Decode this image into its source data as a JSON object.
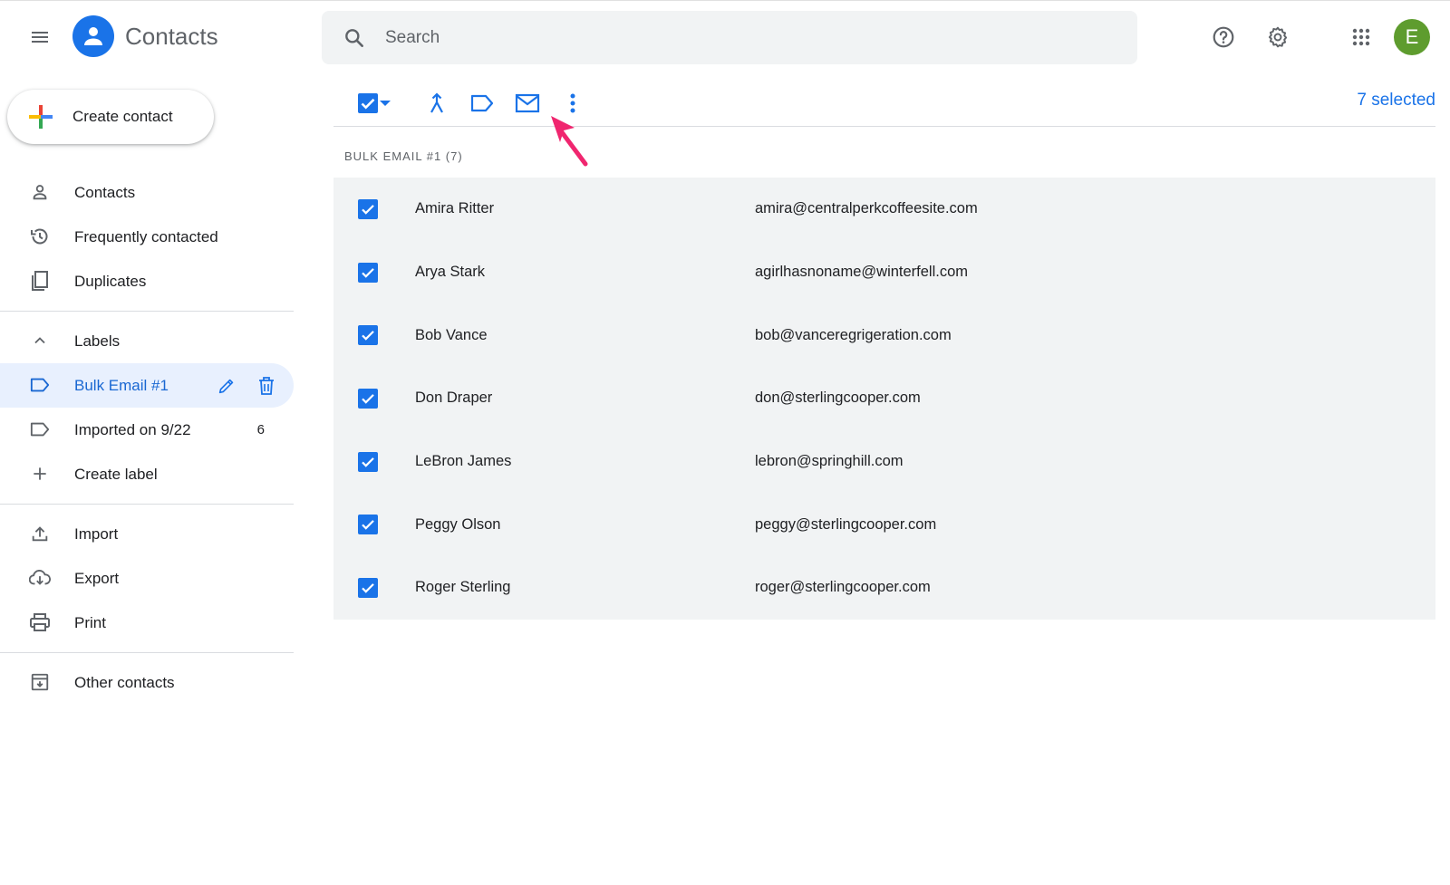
{
  "app": {
    "title": "Contacts",
    "avatar_initial": "E",
    "avatar_color": "#5e9c2e",
    "accent": "#1a73e8"
  },
  "search": {
    "placeholder": "Search"
  },
  "top_icons": [
    "menu-icon",
    "search-icon",
    "help-icon",
    "settings-icon",
    "apps-grid-icon"
  ],
  "create": {
    "label": "Create contact"
  },
  "sidebar": {
    "main_items": [
      {
        "label": "Contacts",
        "icon": "person-icon"
      },
      {
        "label": "Frequently contacted",
        "icon": "history-icon"
      },
      {
        "label": "Duplicates",
        "icon": "duplicates-icon"
      }
    ],
    "labels_header": "Labels",
    "label_items": [
      {
        "label": "Bulk Email #1",
        "icon": "label-icon",
        "active": true
      },
      {
        "label": "Imported on 9/22",
        "icon": "label-icon",
        "count": "6"
      }
    ],
    "create_label": "Create label",
    "tools": [
      {
        "label": "Import",
        "icon": "upload-icon"
      },
      {
        "label": "Export",
        "icon": "cloud-download-icon"
      },
      {
        "label": "Print",
        "icon": "print-icon"
      }
    ],
    "other": {
      "label": "Other contacts",
      "icon": "archive-icon"
    }
  },
  "toolbar": {
    "selected_text": "7 selected",
    "icons": [
      "select-all-checkbox-icon",
      "dropdown-caret-icon",
      "merge-icon",
      "label-icon",
      "email-icon",
      "more-vert-icon"
    ]
  },
  "group": {
    "header": "BULK EMAIL #1 (7)"
  },
  "contacts": [
    {
      "name": "Amira Ritter",
      "email": "amira@centralperkcoffeesite.com",
      "checked": true
    },
    {
      "name": "Arya Stark",
      "email": "agirlhasnoname@winterfell.com",
      "checked": true
    },
    {
      "name": "Bob Vance",
      "email": "bob@vanceregrigeration.com",
      "checked": true
    },
    {
      "name": "Don Draper",
      "email": "don@sterlingcooper.com",
      "checked": true
    },
    {
      "name": "LeBron James",
      "email": "lebron@springhill.com",
      "checked": true
    },
    {
      "name": "Peggy Olson",
      "email": "peggy@sterlingcooper.com",
      "checked": true
    },
    {
      "name": "Roger Sterling",
      "email": "roger@sterlingcooper.com",
      "checked": true
    }
  ],
  "annotation": {
    "arrow_color": "#f0266f",
    "points_to": "email-icon"
  }
}
